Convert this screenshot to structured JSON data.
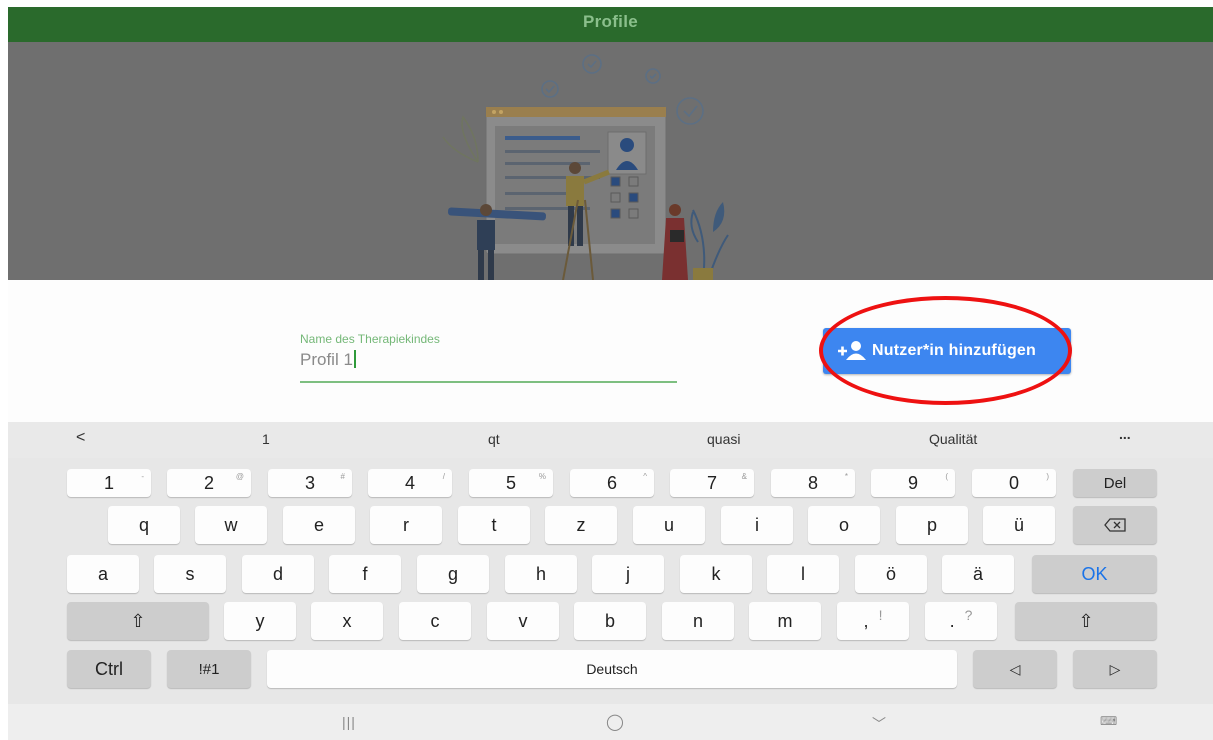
{
  "header": {
    "title": "Profile"
  },
  "form": {
    "name_label": "Name des Therapiekindes",
    "name_value": "Profil 1",
    "add_button": "Nutzer*in hinzufügen"
  },
  "suggestions": {
    "back": "<",
    "items": [
      "1",
      "qt",
      "quasi",
      "Qualität"
    ],
    "more": "..."
  },
  "keyboard": {
    "row1": [
      "1",
      "2",
      "3",
      "4",
      "5",
      "6",
      "7",
      "8",
      "9",
      "0"
    ],
    "row1_sup": [
      "-",
      "@",
      "#",
      "/",
      "%",
      "^",
      "&",
      "*",
      "(",
      ")"
    ],
    "del": "Del",
    "row2": [
      "q",
      "w",
      "e",
      "r",
      "t",
      "z",
      "u",
      "i",
      "o",
      "p",
      "ü"
    ],
    "row3": [
      "a",
      "s",
      "d",
      "f",
      "g",
      "h",
      "j",
      "k",
      "l",
      "ö",
      "ä"
    ],
    "ok": "OK",
    "row4": [
      "y",
      "x",
      "c",
      "v",
      "b",
      "n",
      "m"
    ],
    "comma": ",",
    "comma_sup": "!",
    "period": ".",
    "period_sup": "?",
    "shift": "⇧",
    "ctrl": "Ctrl",
    "sym": "!#1",
    "space": "Deutsch",
    "left": "◁",
    "right": "▷"
  },
  "navbar": {
    "recents": "|||",
    "home": "◯",
    "back": "﹀",
    "keyboard": "⌨"
  },
  "colors": {
    "header_bg": "#2a6a2c",
    "accent_green": "#75b878",
    "button_blue": "#3d86f0",
    "highlight_red": "#ee1111"
  }
}
